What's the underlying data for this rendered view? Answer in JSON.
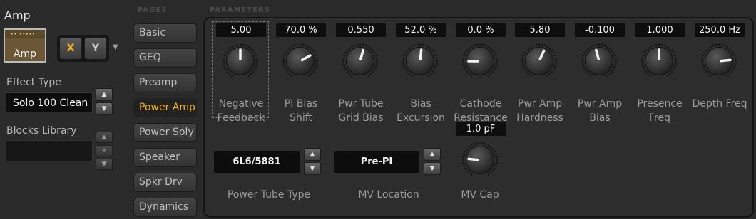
{
  "block": {
    "title": "Amp",
    "icon_label": "Amp",
    "icon_dots": "•• •••••",
    "x_label": "X",
    "y_label": "Y",
    "menu_glyph": "▼"
  },
  "effect_type": {
    "label": "Effect Type",
    "value": "Solo 100 Clean"
  },
  "blocks_library": {
    "label": "Blocks Library",
    "value": "",
    "plus": "+"
  },
  "stepper": {
    "up": "▲",
    "down": "▼"
  },
  "headers": {
    "pages": "PAGES",
    "parameters": "PARAMETERS"
  },
  "pages": [
    {
      "label": "Basic",
      "active": false
    },
    {
      "label": "GEQ",
      "active": false
    },
    {
      "label": "Preamp",
      "active": false
    },
    {
      "label": "Power Amp",
      "active": true
    },
    {
      "label": "Power Sply",
      "active": false
    },
    {
      "label": "Speaker",
      "active": false
    },
    {
      "label": "Spkr Drv",
      "active": false
    },
    {
      "label": "Dynamics",
      "active": false
    }
  ],
  "knobs": [
    {
      "value": "5.00",
      "label1": "Negative",
      "label2": "Feedback",
      "level": 0.5
    },
    {
      "value": "70.0 %",
      "label1": "PI Bias",
      "label2": "Shift",
      "level": 0.7
    },
    {
      "value": "0.550",
      "label1": "Pwr Tube",
      "label2": "Grid Bias",
      "level": 0.55
    },
    {
      "value": "52.0 %",
      "label1": "Bias",
      "label2": "Excursion",
      "level": 0.52
    },
    {
      "value": "0.0 %",
      "label1": "Cathode",
      "label2": "Resistance",
      "level": 0.2
    },
    {
      "value": "5.80",
      "label1": "Pwr Amp",
      "label2": "Hardness",
      "level": 0.58
    },
    {
      "value": "-0.100",
      "label1": "Pwr Amp",
      "label2": "Bias",
      "level": 0.45
    },
    {
      "value": "1.000",
      "label1": "Presence",
      "label2": "Freq",
      "level": 0.5
    },
    {
      "value": "250.0 Hz",
      "label1": "Depth Freq",
      "label2": "",
      "level": 0.78
    }
  ],
  "power_tube_type": {
    "value": "6L6/5881",
    "label": "Power Tube Type"
  },
  "mv_location": {
    "value": "Pre-PI",
    "label": "MV Location"
  },
  "mv_cap": {
    "value": "1.0 pF",
    "label": "MV Cap",
    "level": 0.22
  },
  "colors": {
    "accent": "#f0b020",
    "indicator": "#f2f2f2"
  }
}
